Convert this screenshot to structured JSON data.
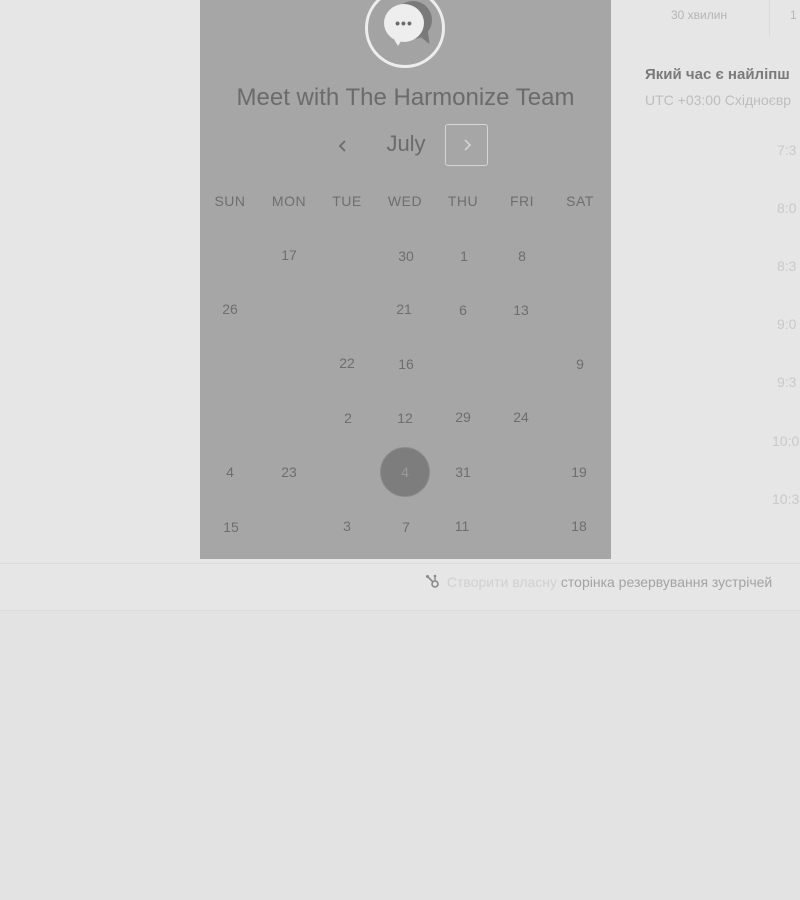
{
  "widget": {
    "title": "Meet with The Harmonize Team",
    "avatar_icon": "chat-bubble-icon",
    "month": "July",
    "prev_icon": "chevron-left-icon",
    "next_icon": "chevron-right-icon",
    "weekdays": [
      "SUN",
      "MON",
      "TUE",
      "WED",
      "THU",
      "FRI",
      "SAT"
    ],
    "days": [
      "17",
      "30",
      "1",
      "8",
      "26",
      "21",
      "6",
      "13",
      "22",
      "16",
      "9",
      "2",
      "12",
      "29",
      "24",
      "4",
      "23",
      "4",
      "31",
      "19",
      "15",
      "3",
      "7",
      "11",
      "18"
    ],
    "selected_day": "4"
  },
  "right": {
    "duration_1": "30 хвилин",
    "duration_2": "1",
    "question": "Який час є найліпш",
    "timezone": "UTC +03:00 Східноєвр",
    "slots": [
      "7:3",
      "8:0",
      "8:3",
      "9:0",
      "9:3",
      "10:0",
      "10:3"
    ]
  },
  "footer": {
    "icon": "hubspot-sprocket-icon",
    "text_light": "Створити власну",
    "text_dark": "сторінка резервування зустрічей"
  },
  "colors": {
    "panel": "#a6a6a6",
    "background": "#e6e6e6",
    "selected_day": "#7d7d7d"
  }
}
